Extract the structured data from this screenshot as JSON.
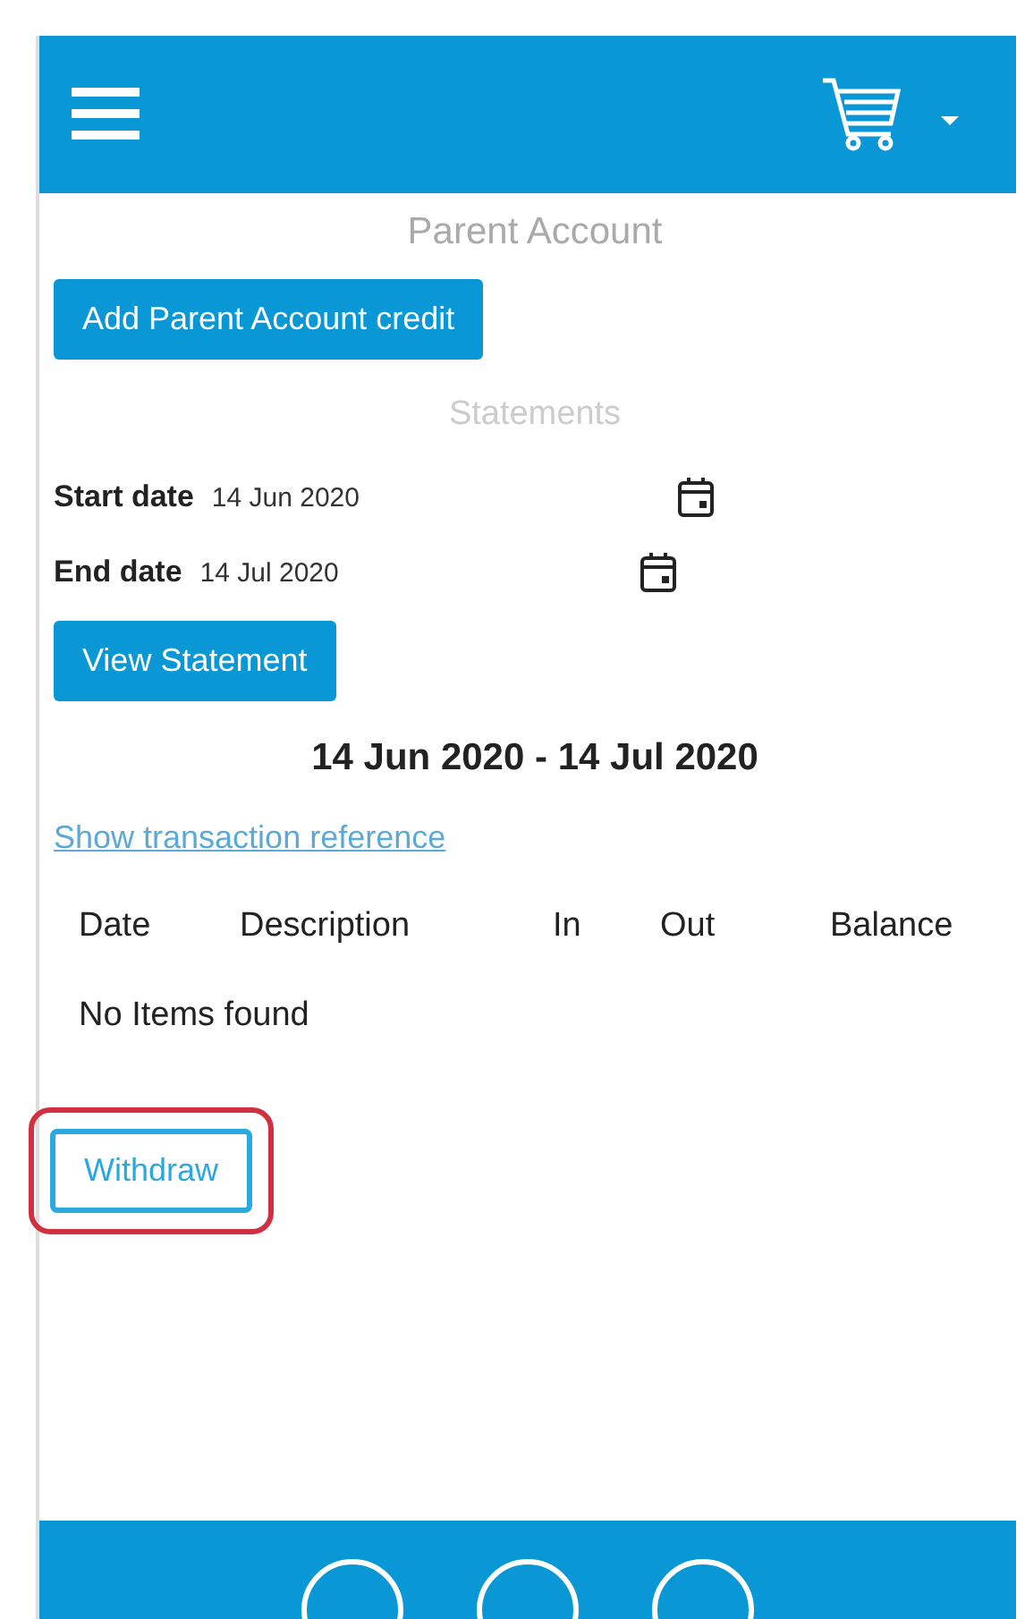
{
  "title": "Parent Account",
  "add_credit_button": "Add Parent Account credit",
  "statements_heading": "Statements",
  "date_fields": [
    {
      "label": "Start date",
      "value": "14 Jun 2020"
    },
    {
      "label": "End date",
      "value": "14 Jul 2020"
    }
  ],
  "view_button": "View Statement",
  "range": "14 Jun 2020 - 14 Jul 2020",
  "reference_link": "Show transaction reference",
  "table": {
    "columns": [
      "Date",
      "Description",
      "In",
      "Out",
      "Balance"
    ],
    "empty_text": "No Items found"
  },
  "withdraw": {
    "label": "Withdraw",
    "highlighted": true
  }
}
